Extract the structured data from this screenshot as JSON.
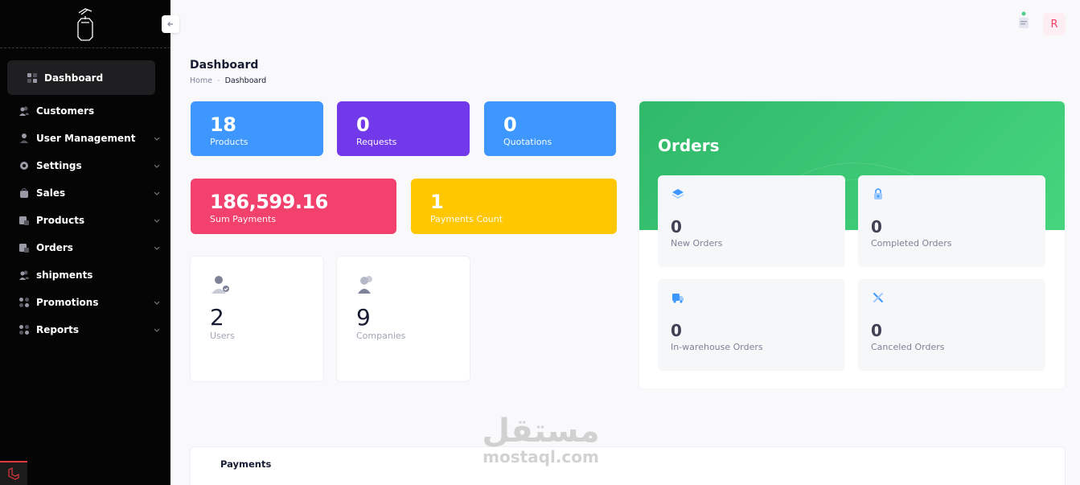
{
  "sidebar": {
    "items": [
      {
        "label": "Dashboard",
        "icon": "grid-icon"
      },
      {
        "label": "Customers",
        "icon": "users-icon"
      },
      {
        "label": "User Management",
        "icon": "user-icon"
      },
      {
        "label": "Settings",
        "icon": "gear-icon"
      },
      {
        "label": "Sales",
        "icon": "bag-icon"
      },
      {
        "label": "Products",
        "icon": "box-icon"
      },
      {
        "label": "Orders",
        "icon": "cart-icon"
      },
      {
        "label": "shipments",
        "icon": "users-icon"
      },
      {
        "label": "Promotions",
        "icon": "grid-icon"
      },
      {
        "label": "Reports",
        "icon": "grid-icon"
      }
    ]
  },
  "header": {
    "avatar_initial": "R"
  },
  "page": {
    "title": "Dashboard",
    "breadcrumb_home": "Home",
    "breadcrumb_sep": "-",
    "breadcrumb_current": "Dashboard"
  },
  "stats": {
    "products": {
      "value": "18",
      "label": "Products",
      "color": "#3e97ff"
    },
    "requests": {
      "value": "0",
      "label": "Requests",
      "color": "#7239ea"
    },
    "quotations": {
      "value": "0",
      "label": "Quotations",
      "color": "#3e97ff"
    },
    "sum_payments": {
      "value": "186,599.16",
      "label": "Sum Payments",
      "color": "#f1416c"
    },
    "payments_count": {
      "value": "1",
      "label": "Payments Count",
      "color": "#ffc700"
    },
    "users": {
      "value": "2",
      "label": "Users"
    },
    "companies": {
      "value": "9",
      "label": "Companies"
    }
  },
  "orders": {
    "title": "Orders",
    "new": {
      "value": "0",
      "label": "New Orders"
    },
    "completed": {
      "value": "0",
      "label": "Completed Orders"
    },
    "warehouse": {
      "value": "0",
      "label": "In-warehouse Orders"
    },
    "canceled": {
      "value": "0",
      "label": "Canceled Orders"
    }
  },
  "payments_section": {
    "title": "Payments"
  },
  "watermark": {
    "arabic": "مستقل",
    "latin": "mostaql.com"
  }
}
